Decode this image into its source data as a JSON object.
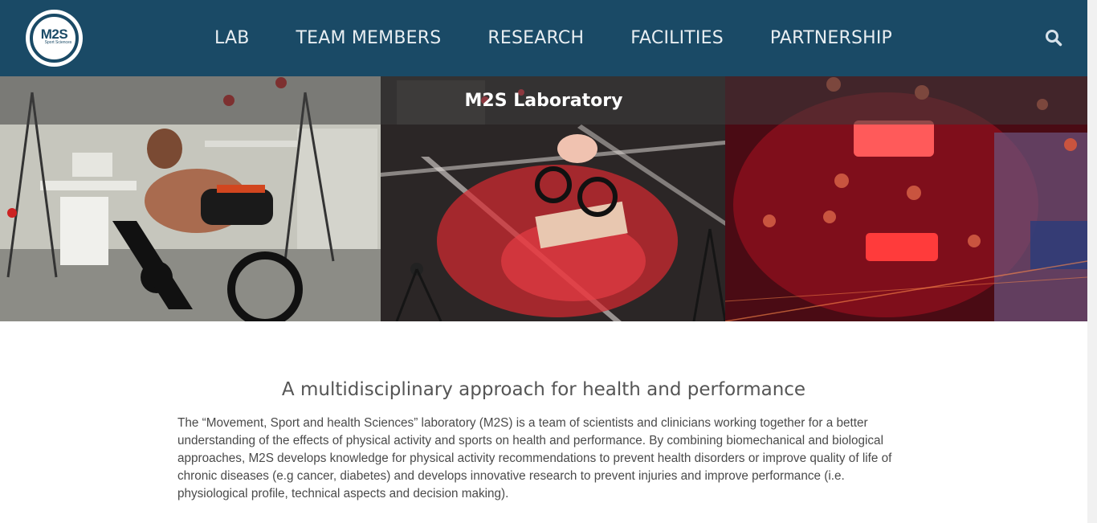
{
  "header": {
    "logo": {
      "main": "M2S",
      "sub": "Sport Sciences"
    },
    "nav": [
      {
        "label": "LAB"
      },
      {
        "label": "TEAM MEMBERS"
      },
      {
        "label": "RESEARCH"
      },
      {
        "label": "FACILITIES"
      },
      {
        "label": "PARTNERSHIP"
      }
    ],
    "search_icon": "search-icon",
    "background_color": "#1a4a66"
  },
  "hero": {
    "title": "M2S Laboratory",
    "images": [
      "cyclist-lab-photo",
      "cyclist-motion-capture-photo",
      "markers-closeup-photo"
    ]
  },
  "main": {
    "heading": "A multidisciplinary approach for health and performance",
    "paragraph": "The “Movement, Sport and health Sciences” laboratory (M2S) is a team of scientists and clinicians working together for a better understanding of the effects of physical activity and sports on health and performance. By combining biomechanical and biological approaches, M2S develops knowledge for physical activity recommendations to prevent health disorders or improve quality of life of chronic diseases (e.g cancer, diabetes) and develops innovative research to prevent injuries and improve performance (i.e. physiological profile, technical aspects and decision making)."
  }
}
